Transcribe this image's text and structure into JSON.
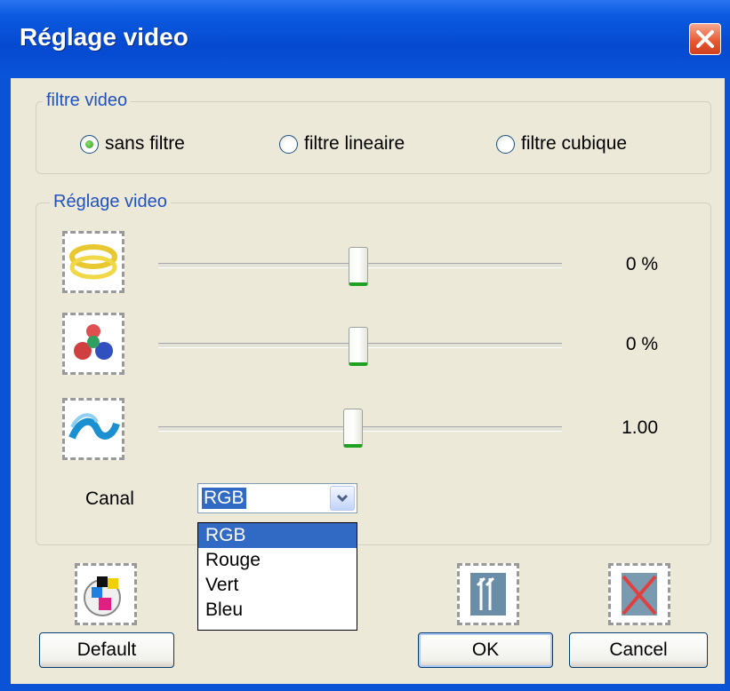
{
  "window": {
    "title": "Réglage video"
  },
  "filter_group": {
    "legend": "filtre video",
    "options": [
      {
        "label": "sans filtre",
        "selected": true
      },
      {
        "label": "filtre lineaire",
        "selected": false
      },
      {
        "label": "filtre cubique",
        "selected": false
      }
    ]
  },
  "adjust_group": {
    "legend": "Réglage video",
    "sliders": [
      {
        "icon": "brightness-icon",
        "value_text": "0 %",
        "position": 0.5
      },
      {
        "icon": "contrast-icon",
        "value_text": "0 %",
        "position": 0.5
      },
      {
        "icon": "gamma-icon",
        "value_text": "1.00",
        "position": 0.44
      }
    ],
    "channel": {
      "label": "Canal",
      "selected": "RGB",
      "options": [
        "RGB",
        "Rouge",
        "Vert",
        "Bleu"
      ]
    }
  },
  "buttons": {
    "default": "Default",
    "ok": "OK",
    "cancel": "Cancel"
  },
  "colors": {
    "titlebar": "#0549d0",
    "dialog": "#ece9d8",
    "legend": "#1f52c3",
    "selection": "#316ac5",
    "thumb_accent": "#21a121"
  }
}
